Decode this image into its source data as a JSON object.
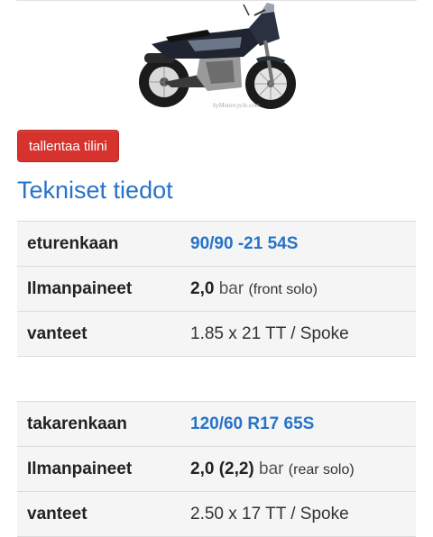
{
  "save_button": "tallentaa tilini",
  "section_title": "Tekniset tiedot",
  "front": {
    "tire_label": "eturenkaan",
    "tire_value": "90/90 -21 54S",
    "pressure_label": "Ilmanpaineet",
    "pressure_value": "2,0",
    "pressure_unit": "bar",
    "pressure_note": "(front solo)",
    "rim_label": "vanteet",
    "rim_value": "1.85 x 21 TT / Spoke"
  },
  "rear": {
    "tire_label": "takarenkaan",
    "tire_value": "120/60 R17 65S",
    "pressure_label": "Ilmanpaineet",
    "pressure_value": "2,0 (2,2)",
    "pressure_unit": "bar",
    "pressure_note": "(rear solo)",
    "rim_label": "vanteet",
    "rim_value": "2.50 x 17 TT / Spoke"
  },
  "colors": {
    "accent": "#2673c8",
    "button": "#d6322e"
  }
}
